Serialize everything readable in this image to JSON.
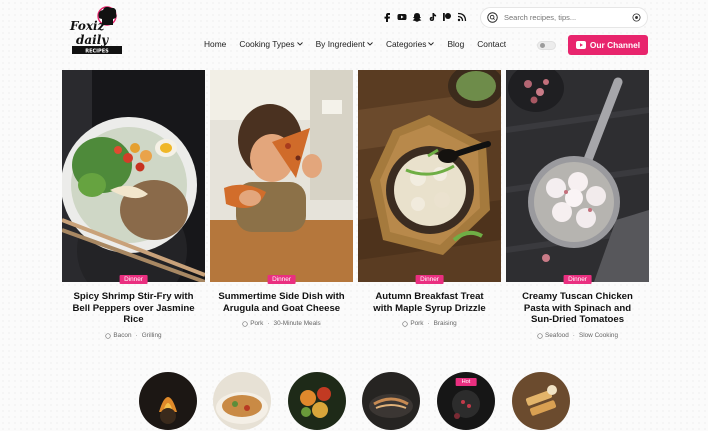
{
  "brand": {
    "logo_line1": "Foxiz",
    "logo_line2": "daily",
    "logo_line3": "RECIPES",
    "accent": "#e8256d"
  },
  "social_icons": [
    "facebook-icon",
    "youtube-icon",
    "snapchat-icon",
    "tiktok-icon",
    "patreon-icon",
    "rss-icon"
  ],
  "search": {
    "placeholder": "Search recipes, tips..."
  },
  "nav": [
    {
      "label": "Home",
      "has_dropdown": false
    },
    {
      "label": "Cooking Types",
      "has_dropdown": true
    },
    {
      "label": "By Ingredient",
      "has_dropdown": true
    },
    {
      "label": "Categories",
      "has_dropdown": true
    },
    {
      "label": "Blog",
      "has_dropdown": false
    },
    {
      "label": "Contact",
      "has_dropdown": false
    }
  ],
  "channel_button": {
    "label": "Our Channel"
  },
  "cards": [
    {
      "category": "Dinner",
      "title_lines": [
        "Spicy Shrimp Stir-Fry with",
        "Bell Peppers over Jasmine",
        "Rice"
      ],
      "tags": [
        "Bacon",
        "Grilling"
      ]
    },
    {
      "category": "Dinner",
      "title_lines": [
        "Summertime Side Dish with",
        "Arugula and Goat Cheese"
      ],
      "tags": [
        "Pork",
        "30-Minute Meals"
      ]
    },
    {
      "category": "Dinner",
      "title_lines": [
        "Autumn Breakfast Treat",
        "with Maple Syrup Drizzle"
      ],
      "tags": [
        "Pork",
        "Braising"
      ]
    },
    {
      "category": "Dinner",
      "title_lines": [
        "Creamy Tuscan Chicken",
        "Pasta with Spinach and",
        "Sun-Dried Tomatoes"
      ],
      "tags": [
        "Seafood",
        "Slow Cooking"
      ]
    }
  ],
  "circle_tags": [
    "",
    "",
    "",
    "",
    "Hot",
    ""
  ]
}
